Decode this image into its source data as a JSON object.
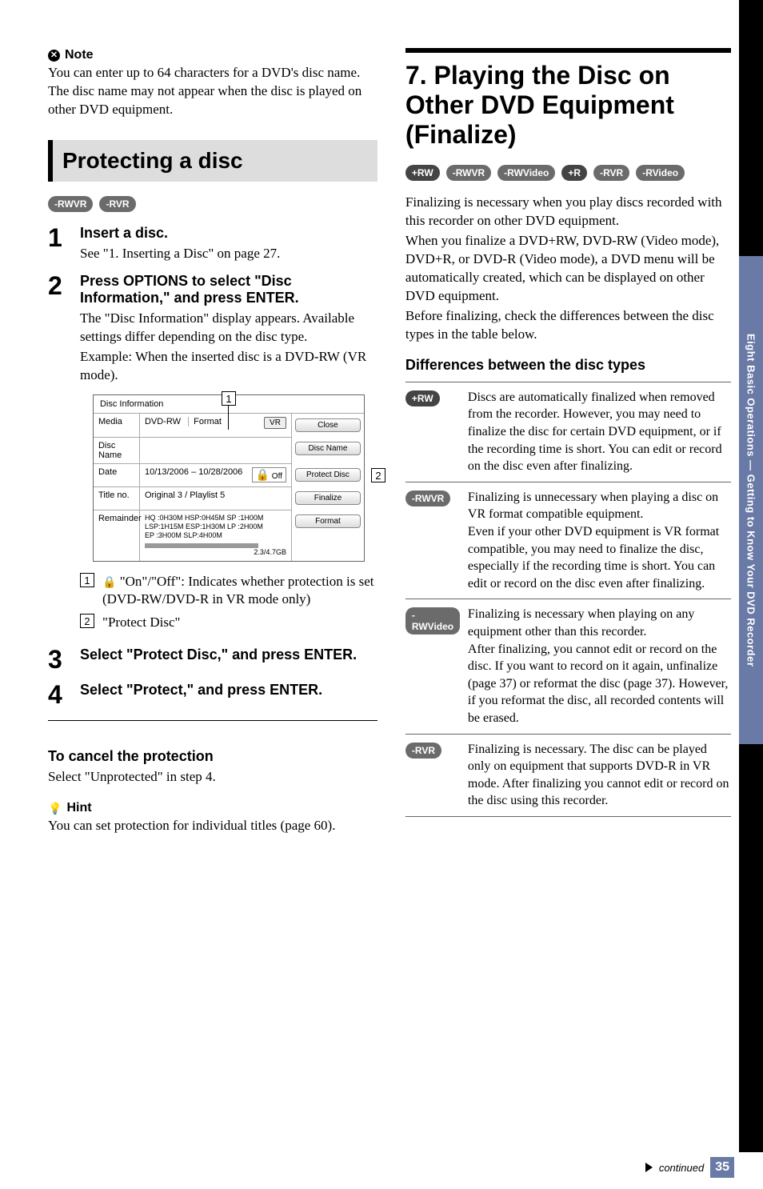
{
  "side_tab": "Eight Basic Operations — Getting to Know Your DVD Recorder",
  "footer": {
    "continued": "continued",
    "page": "35"
  },
  "left": {
    "note_label": "Note",
    "note_text": "You can enter up to 64 characters for a DVD's disc name. The disc name may not appear when the disc is played on other DVD equipment.",
    "section_title": "Protecting a disc",
    "badges": [
      "-RWVR",
      "-RVR"
    ],
    "step1": {
      "title": "Insert a disc.",
      "text": "See \"1. Inserting a Disc\" on page 27."
    },
    "step2": {
      "title": "Press OPTIONS to select \"Disc Information,\" and press ENTER.",
      "text1": "The \"Disc Information\" display appears. Available settings differ depending on the disc type.",
      "text2": "Example: When the inserted disc is a DVD-RW (VR mode)."
    },
    "figure": {
      "title": "Disc Information",
      "rows": {
        "media_label": "Media",
        "media_val": "DVD-RW",
        "format_label": "Format",
        "format_val": "VR",
        "discname_label": "Disc Name",
        "date_label": "Date",
        "date_val": "10/13/2006 – 10/28/2006",
        "off": "Off",
        "title_label": "Title no.",
        "title_val": "Original  3 / Playlist  5",
        "rem_label": "Remainder",
        "rem_l1": "HQ :0H30M HSP:0H45M SP  :1H00M",
        "rem_l2": "LSP:1H15M ESP:1H30M LP  :2H00M",
        "rem_l3": "EP  :3H00M SLP:4H00M",
        "rem_cap": "2.3/4.7GB"
      },
      "buttons": {
        "close": "Close",
        "discname": "Disc Name",
        "protect": "Protect Disc",
        "finalize": "Finalize",
        "format": "Format"
      },
      "callout1_text": " \"On\"/\"Off\": Indicates whether protection is set (DVD-RW/DVD-R in VR mode only)",
      "callout2_text": "\"Protect Disc\""
    },
    "step3_title": "Select \"Protect Disc,\" and press ENTER.",
    "step4_title": "Select \"Protect,\" and press ENTER.",
    "cancel_title": "To cancel the protection",
    "cancel_text": "Select \"Unprotected\" in step 4.",
    "hint_label": "Hint",
    "hint_text": "You can set protection for individual titles (page 60)."
  },
  "right": {
    "heading": "7. Playing the Disc on Other DVD Equipment (Finalize)",
    "badges": [
      "+RW",
      "-RWVR",
      "-RWVideo",
      "+R",
      "-RVR",
      "-RVideo"
    ],
    "para1": "Finalizing is necessary when you play discs recorded with this recorder on other DVD equipment.",
    "para2": "When you finalize a DVD+RW, DVD-RW (Video mode), DVD+R, or DVD-R (Video mode), a DVD menu will be automatically created, which can be displayed on other DVD equipment.",
    "para3": "Before finalizing, check the differences between the disc types in the table below.",
    "diff_title": "Differences between the disc types",
    "types": [
      {
        "badge": "+RW",
        "desc": "Discs are automatically finalized when removed from the recorder. However, you may need to finalize the disc for certain DVD equipment, or if the recording time is short. You can edit or record on the disc even after finalizing."
      },
      {
        "badge": "-RWVR",
        "desc": "Finalizing is unnecessary when playing a disc on VR format compatible equipment.\nEven if your other DVD equipment is VR format compatible, you may need to finalize the disc, especially if the recording time is short. You can edit or record on the disc even after finalizing."
      },
      {
        "badge": "-RWVideo",
        "desc": "Finalizing is necessary when playing on any equipment other than this recorder.\nAfter finalizing, you cannot edit or record on the disc. If you want to record on it again, unfinalize (page 37) or reformat the disc (page 37). However, if you reformat the disc, all recorded contents will be erased."
      },
      {
        "badge": "-RVR",
        "desc": "Finalizing is necessary. The disc can be played only on equipment that supports DVD-R in VR mode. After finalizing you cannot edit or record on the disc using this recorder."
      }
    ]
  }
}
